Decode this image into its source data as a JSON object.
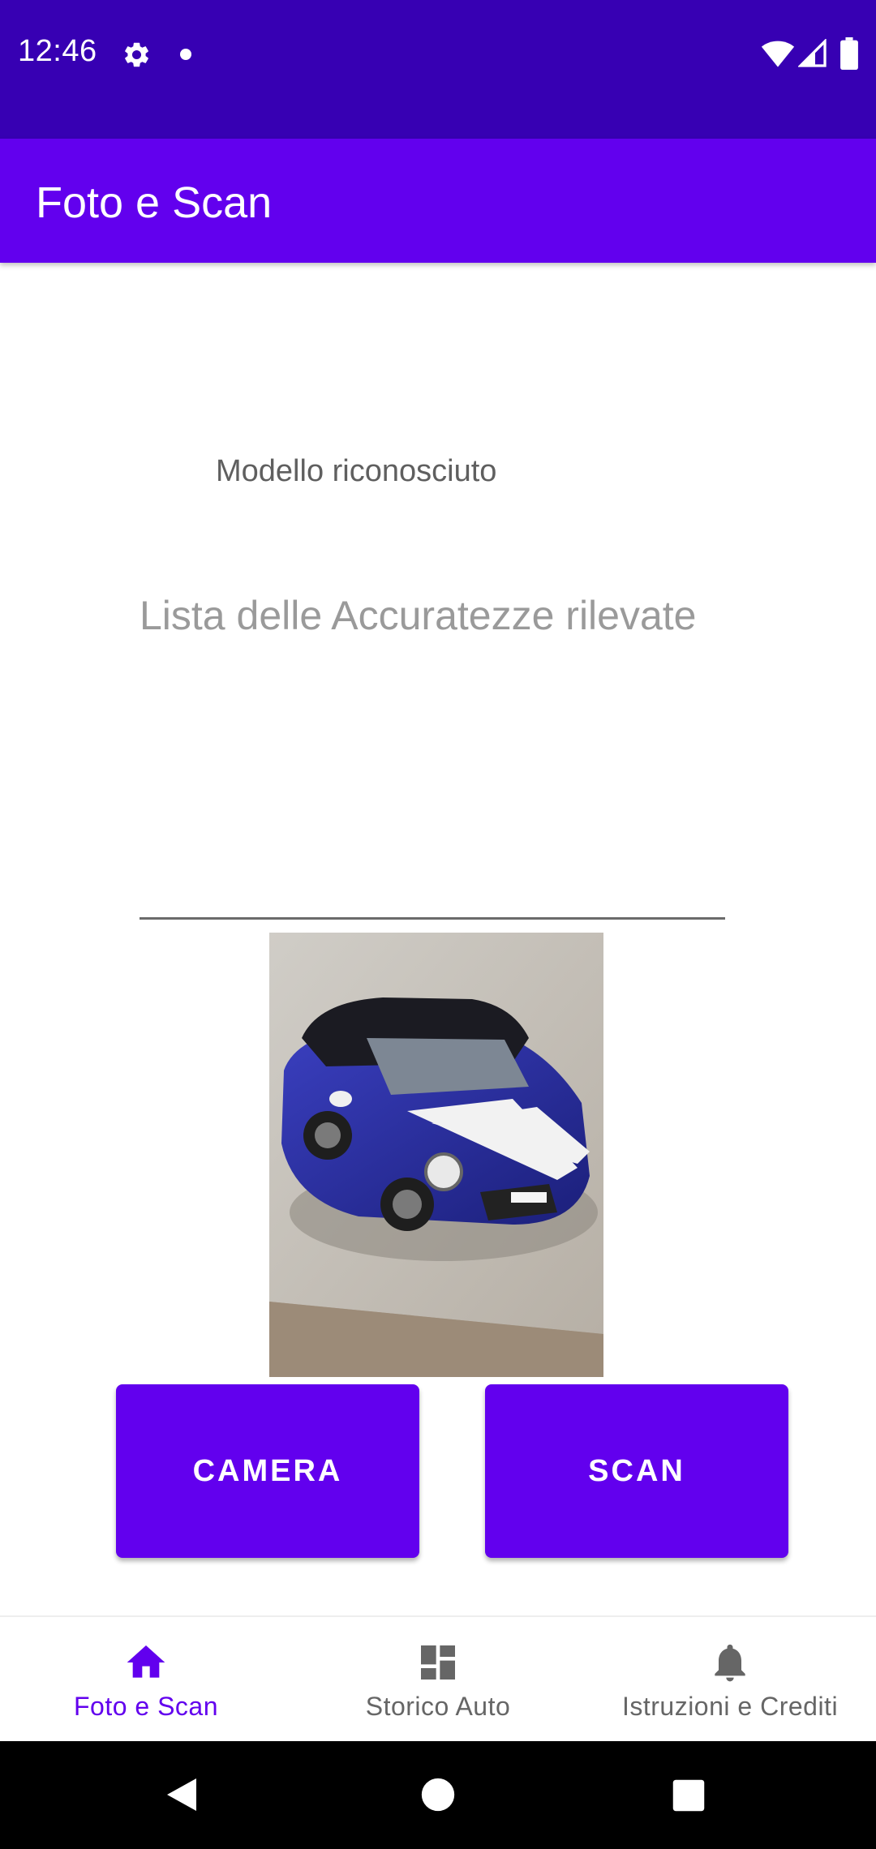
{
  "status_bar": {
    "time": "12:46",
    "icons": [
      "gear-icon",
      "notification-dot",
      "wifi-icon",
      "signal-icon",
      "battery-icon"
    ]
  },
  "app_bar": {
    "title": "Foto e Scan"
  },
  "main": {
    "model_label": "Modello riconosciuto",
    "accuracy_hint": "Lista delle Accuratezze rilevate",
    "camera_label": "CAMERA",
    "scan_label": "SCAN"
  },
  "bottom_nav": {
    "items": [
      {
        "label": "Foto e Scan",
        "icon": "home-icon",
        "active": true
      },
      {
        "label": "Storico Auto",
        "icon": "dashboard-icon",
        "active": false
      },
      {
        "label": "Istruzioni e Crediti",
        "icon": "bell-icon",
        "active": false
      }
    ]
  },
  "system_nav": {
    "icons": [
      "back-icon",
      "home-circle-icon",
      "recents-icon"
    ]
  },
  "colors": {
    "status_bar": "#3700B3",
    "primary": "#6200EE",
    "inactive_nav": "#666666"
  }
}
